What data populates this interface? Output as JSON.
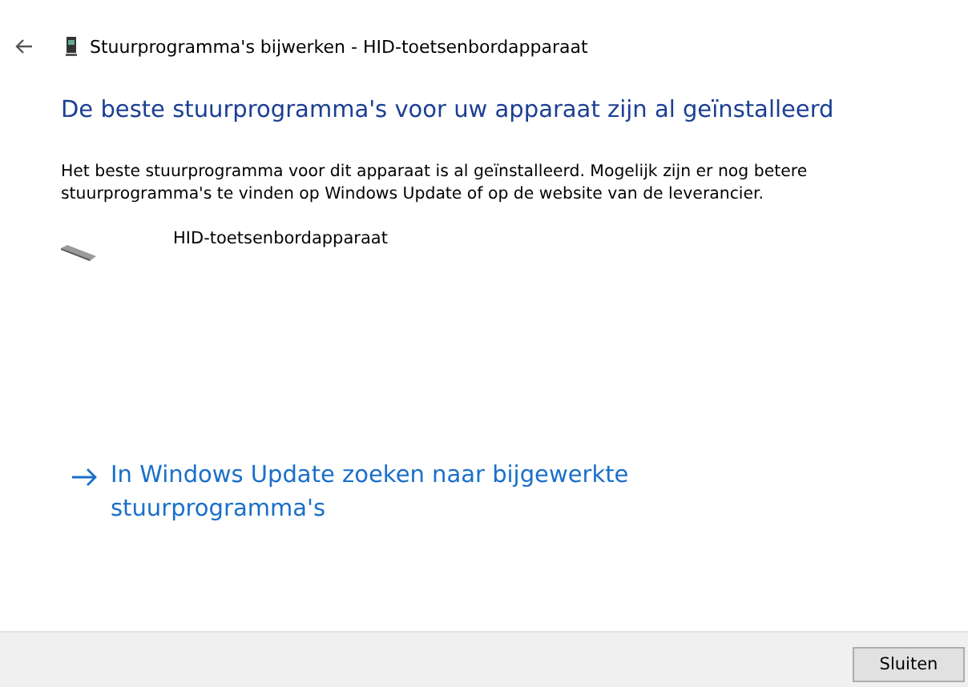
{
  "window": {
    "title": "Stuurprogramma's bijwerken - HID-toetsenbordapparaat"
  },
  "heading": "De beste stuurprogramma's voor uw apparaat zijn al geïnstalleerd",
  "description": "Het beste stuurprogramma voor dit apparaat is al geïnstalleerd. Mogelijk zijn er nog betere stuurprogramma's te vinden op Windows Update of op de website van de leverancier.",
  "device": {
    "name": "HID-toetsenbordapparaat"
  },
  "link": {
    "label": "In Windows Update zoeken naar bijgewerkte stuurprogramma's"
  },
  "buttons": [
    "Sluiten"
  ]
}
